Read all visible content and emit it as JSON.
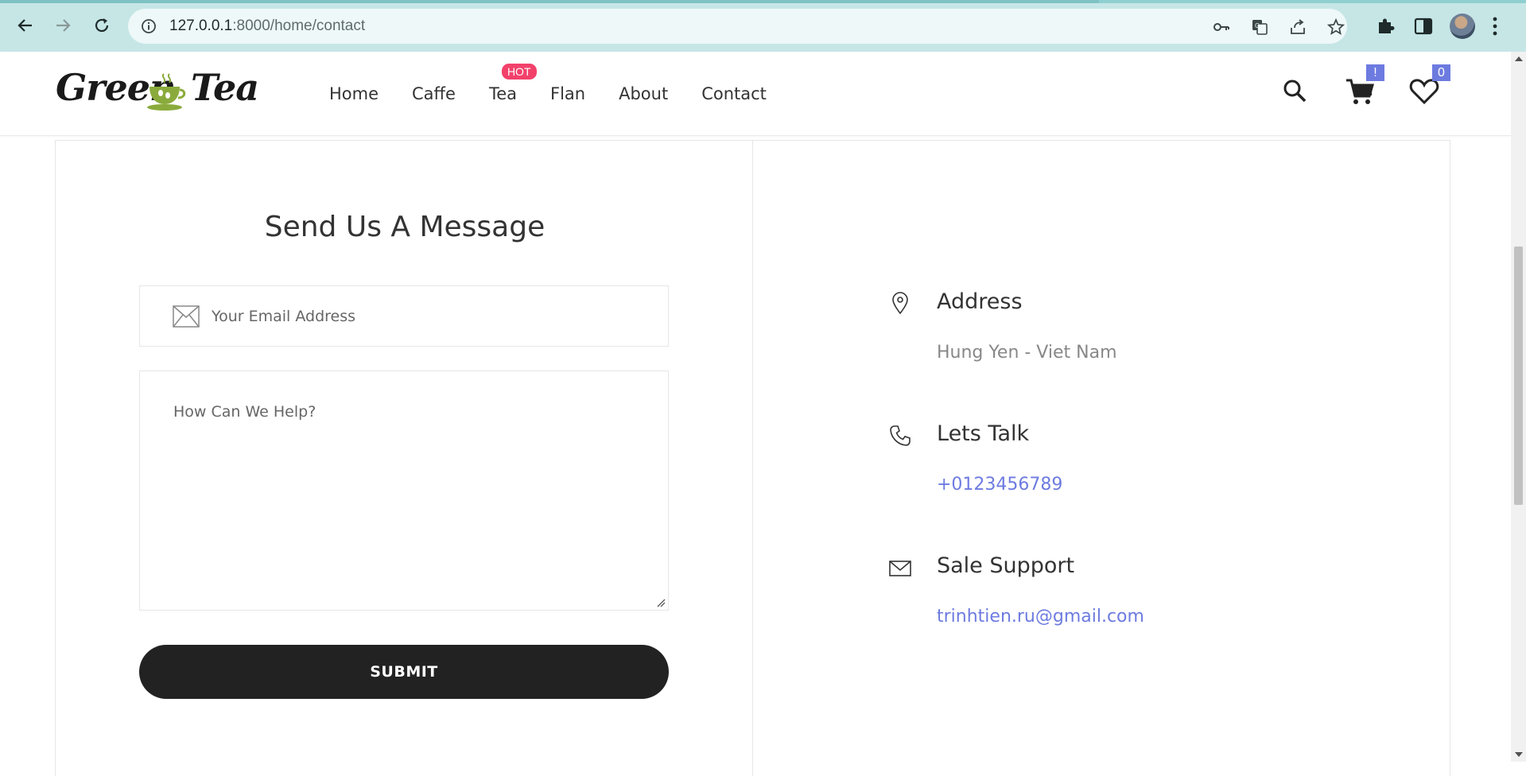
{
  "browser": {
    "url_host": "127.0.0.1",
    "url_path": ":8000/home/contact"
  },
  "site": {
    "logo_left": "Green",
    "logo_right": "Tea",
    "menu": [
      {
        "label": "Home"
      },
      {
        "label": "Caffe"
      },
      {
        "label": "Tea",
        "badge": "HOT"
      },
      {
        "label": "Flan"
      },
      {
        "label": "About"
      },
      {
        "label": "Contact"
      }
    ],
    "cart_badge": "!",
    "wishlist_count": "0"
  },
  "form": {
    "title": "Send Us A Message",
    "email_placeholder": "Your Email Address",
    "message_placeholder": "How Can We Help?",
    "submit_label": "SUBMIT"
  },
  "contact_info": {
    "address_title": "Address",
    "address_value": "Hung Yen - Viet Nam",
    "phone_title": "Lets Talk",
    "phone_value": "+0123456789",
    "email_title": "Sale Support",
    "email_value": "trinhtien.ru@gmail.com"
  },
  "colors": {
    "accent": "#6d7be0",
    "hot_badge": "#f2416b",
    "button": "#222222",
    "chrome": "#c6e6e6"
  }
}
